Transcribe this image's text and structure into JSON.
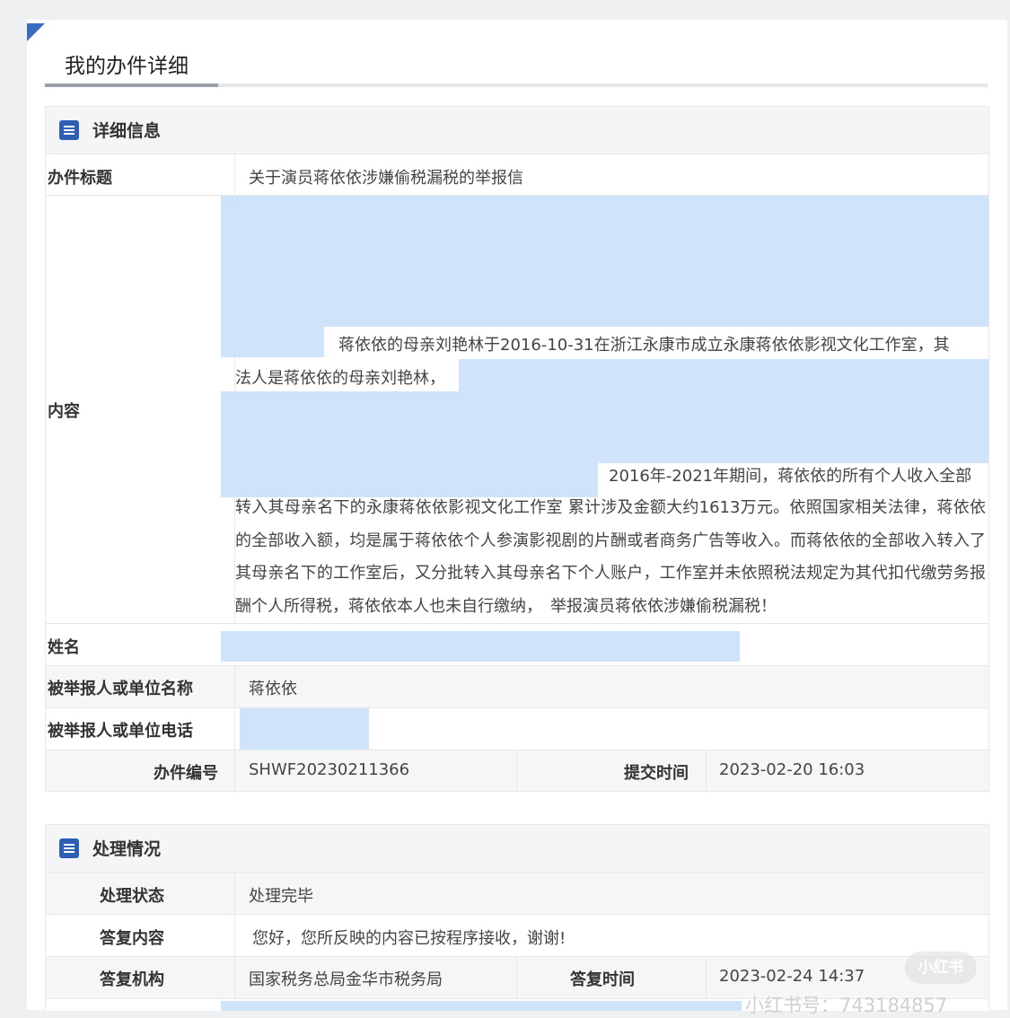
{
  "page": {
    "title": "我的办件详细"
  },
  "details": {
    "section_title": "详细信息",
    "subject_label": "办件标题",
    "subject_value": "关于演员蒋依依涉嫌偷税漏税的举报信",
    "content_label": "内容",
    "content_line1": "蒋依依的母亲刘艳林于2016-10-31在浙江永康市成立永康蒋依依影视文化工作室，其",
    "content_line2": "法人是蒋依依的母亲刘艳林，",
    "content_line3": "2016年-2021年期间，蒋依依的所有个人收入全部",
    "content_body": "转入其母亲名下的永康蒋依依影视文化工作室 累计涉及金额大约1613万元。依照国家相关法律，蒋依依的全部收入额，均是属于蒋依依个人参演影视剧的片酬或者商务广告等收入。而蒋依依的全部收入转入了其母亲名下的工作室后，又分批转入其母亲名下个人账户，工作室并未依照税法规定为其代扣代缴劳务报酬个人所得税，蒋依依本人也未自行缴纳，　举报演员蒋依依涉嫌偷税漏税！",
    "name_label": "姓名",
    "reported_label": "被举报人或单位名称",
    "reported_value": "蒋依依",
    "phone_label": "被举报人或单位电话",
    "case_no_label": "办件编号",
    "case_no_value": "SHWF20230211366",
    "submit_time_label": "提交时间",
    "submit_time_value": "2023-02-20 16:03"
  },
  "handling": {
    "section_title": "处理情况",
    "status_label": "处理状态",
    "status_value": "处理完毕",
    "reply_label": "答复内容",
    "reply_value": "您好，您所反映的内容已按程序接收，谢谢!",
    "agency_label": "答复机构",
    "agency_value": "国家税务总局金华市税务局",
    "reply_time_label": "答复时间",
    "reply_time_value": "2023-02-24 14:37"
  },
  "watermark": {
    "brand": "小红书",
    "id_text": "小红书号：743184857"
  },
  "colors": {
    "accent": "#2f5eb5",
    "redaction": "#cfe4fb",
    "row_alt": "#f5f6f7"
  }
}
